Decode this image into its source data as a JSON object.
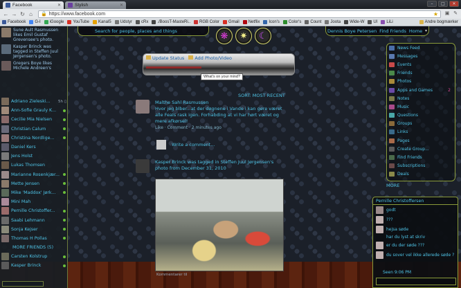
{
  "browser": {
    "tabs": [
      {
        "label": "Facebook",
        "color": "#3b5998",
        "active": true
      },
      {
        "label": "Stylish",
        "color": "#6a3fa0",
        "active": false
      }
    ],
    "url": "https://www.facebook.com",
    "bookmarks": [
      {
        "label": "Facebook",
        "color": "#3b5998"
      },
      {
        "label": "G-I",
        "color": "#4285f4"
      },
      {
        "label": "iGoogle",
        "color": "#34a853"
      },
      {
        "label": "YouTube",
        "color": "#d93025"
      },
      {
        "label": "Kanal5",
        "color": "#e6a100"
      },
      {
        "label": "Udstyr",
        "color": "#777777"
      },
      {
        "label": "cRx",
        "color": "#555555"
      },
      {
        "label": "./BoosT-MasteRi..",
        "color": "#444444"
      },
      {
        "label": "RGB Color",
        "color": "#cc3333"
      },
      {
        "label": "Gmail",
        "color": "#d93025"
      },
      {
        "label": "Netflix",
        "color": "#b00710"
      },
      {
        "label": "Icon's",
        "color": "#3366aa"
      },
      {
        "label": "Color's",
        "color": "#2d8c2d"
      },
      {
        "label": "Count",
        "color": "#666666"
      },
      {
        "label": "Joota",
        "color": "#777777"
      },
      {
        "label": "Wide-W",
        "color": "#444444"
      },
      {
        "label": "UI",
        "color": "#555555"
      },
      {
        "label": "LiLi",
        "color": "#8a4fb0"
      }
    ],
    "other_bookmarks": "Andre bogmærker"
  },
  "header": {
    "search_placeholder": "Search for people, places and things",
    "user_name": "Dennis Boye Petersen",
    "find_friends": "Find Friends",
    "home": "Home"
  },
  "ticker": [
    {
      "text": "Sune Ault Rasmussen likes Emil Gustaf Grevensee's photo.",
      "color": "#8a7a6a"
    },
    {
      "text": "Kasper Brinck was tagged in Steffen Juul Jørgensen's photo.",
      "color": "#5a6a7a"
    },
    {
      "text": "Gregers Boye likes Michele Andreen's",
      "color": "#6a5a5a"
    }
  ],
  "chat_friends": [
    {
      "name": "Adriano Zieleski...",
      "status": "5h",
      "dot": false,
      "color": "#7a6a5a"
    },
    {
      "name": "Ann-Sofie Grauly K...",
      "status": "",
      "dot": true,
      "color": "#a08a7a"
    },
    {
      "name": "Cecilie Mia Nielsen",
      "status": "",
      "dot": true,
      "color": "#8a6a6a"
    },
    {
      "name": "Christian Calum",
      "status": "",
      "dot": true,
      "color": "#6a6a7a"
    },
    {
      "name": "Christina Nordlige...",
      "status": "",
      "dot": true,
      "color": "#9a7a7a"
    },
    {
      "name": "Daniel Kers",
      "status": "",
      "dot": false,
      "color": "#5a5a6a"
    },
    {
      "name": "Jens Holst",
      "status": "",
      "dot": false,
      "color": "#7a7a7a"
    },
    {
      "name": "Lukas Thomsen",
      "status": "",
      "dot": false,
      "color": "#6a5a4a"
    },
    {
      "name": "Marianne Rosenkjær...",
      "status": "",
      "dot": true,
      "color": "#9a8a8a"
    },
    {
      "name": "Mette Jensen",
      "status": "",
      "dot": true,
      "color": "#8a7a6a"
    },
    {
      "name": "Mike 'Maddox' Jørk...",
      "status": "",
      "dot": true,
      "color": "#5a6a5a"
    },
    {
      "name": "Mini Mah",
      "status": "",
      "dot": false,
      "color": "#aa8a9a"
    },
    {
      "name": "Pernille Christoffer...",
      "status": "",
      "dot": true,
      "color": "#9a6a6a"
    },
    {
      "name": "Saabi Lehmann",
      "status": "",
      "dot": true,
      "color": "#6a6a6a"
    },
    {
      "name": "Sonja Kejser",
      "status": "",
      "dot": true,
      "color": "#8a8a7a"
    },
    {
      "name": "Thomas H Pollas",
      "status": "",
      "dot": true,
      "color": "#7a6a6a"
    }
  ],
  "more_friends": "MORE FRIENDS (5)",
  "chat_friends_extra": [
    {
      "name": "Carsten Kolstrup",
      "dot": true,
      "color": "#6a6a5a"
    },
    {
      "name": "Kasper Brinck",
      "dot": true,
      "color": "#5a5a5a"
    }
  ],
  "composer": {
    "update_status": "Update Status",
    "add_photo": "Add Photo/Video",
    "tooltip": "What's on your mind?"
  },
  "sort_label": "SORT: MOST RECENT",
  "stories": [
    {
      "author": "Malthe Sahl Rasmussen",
      "text": "Hvor jeg blber...at der døgnene i Vande i kan gøre været alle Feals rask igen. Forhabding at vi har hørt været og mere afkørsel!",
      "meta": "Like · Comment · 2 minutes ago",
      "avatar_color": "#8a7a7a"
    },
    {
      "author": "Kasper Brinck",
      "text": "Kasper Brinck was tagged in Steffen Juul Jørgensen's photo from December 31, 2010",
      "meta": "",
      "avatar_color": "#3a3a3a"
    }
  ],
  "write_comment": "Write a comment...",
  "photo_caption": "Kommentarer til",
  "right_nav": [
    {
      "label": "News Feed",
      "count": "",
      "color": "#4a6ea8"
    },
    {
      "label": "Messages",
      "count": "",
      "color": "#5a7ab0"
    },
    {
      "label": "Events",
      "count": "",
      "color": "#c84a4a"
    },
    {
      "label": "Friends",
      "count": "",
      "color": "#4a8a4a"
    },
    {
      "label": "Photos",
      "count": "",
      "color": "#a88a3a"
    },
    {
      "label": "Apps and Games",
      "count": "2",
      "color": "#6a4aa8"
    },
    {
      "label": "Notes",
      "count": "",
      "color": "#7a7a4a"
    },
    {
      "label": "Music",
      "count": "",
      "color": "#a84a8a"
    },
    {
      "label": "Questions",
      "count": "",
      "color": "#4aa8a8"
    },
    {
      "label": "Groups",
      "count": "",
      "color": "#8a6a3a"
    },
    {
      "label": "Links",
      "count": "",
      "color": "#3a6a8a"
    },
    {
      "label": "Pages",
      "count": "",
      "color": "#a86a4a"
    },
    {
      "label": "Create Group...",
      "count": "",
      "color": "#5a5a5a"
    },
    {
      "label": "Find Friends",
      "count": "",
      "color": "#4a6a4a"
    },
    {
      "label": "Subscriptions",
      "count": "",
      "color": "#6a4a4a"
    },
    {
      "label": "Deals",
      "count": "",
      "color": "#8a8a4a"
    }
  ],
  "right_more": "MORE",
  "chat_window": {
    "title": "Pernille Christoffersen",
    "messages": [
      {
        "text": "godt",
        "color": "#9a8a8a",
        "avatar": true
      },
      {
        "text": "???",
        "color": "#c0b0b0",
        "avatar": true
      },
      {
        "text": "hejsa søde",
        "color": "#c0b0b0",
        "avatar": true
      },
      {
        "text": "har du lyst at skriv",
        "color": "",
        "avatar": false
      },
      {
        "text": "er du der søde ???",
        "color": "#c0b0b0",
        "avatar": true
      },
      {
        "text": "du sover vel ikke allerede søde ?",
        "color": "#c0b0b0",
        "avatar": true
      }
    ],
    "seen": "Seen 9:06 PM"
  }
}
